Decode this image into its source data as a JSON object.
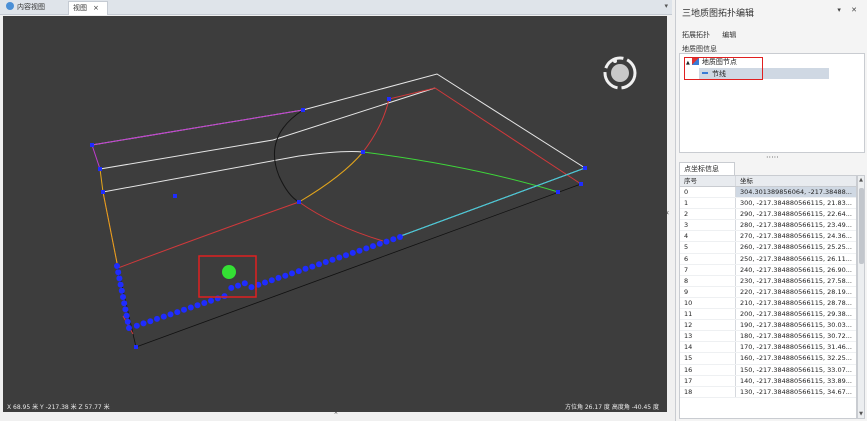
{
  "tabs": [
    {
      "label": "内容视图",
      "icon": "view-content-icon"
    },
    {
      "label": "视图",
      "close": "×",
      "icon": "view-icon"
    }
  ],
  "tab_dropdown": "▾",
  "status": {
    "left": "X 68.95  米   Y -217.38  米   Z 57.77  米",
    "right": "方位角   26.17  度  高度角  -40.45  度"
  },
  "panel": {
    "title": "三地质图拓扑编辑",
    "title_icons": "▾ ✕",
    "toolbar": [
      "拓展拓扑",
      "编辑"
    ],
    "group_label": "地质图信息",
    "tree": [
      {
        "label": "地质图节点",
        "expander": "▲"
      },
      {
        "label": "节线"
      }
    ],
    "splitter": "·····",
    "coord_tab": "点坐标信息",
    "columns": [
      "序号",
      "坐标"
    ],
    "rows": [
      {
        "id": "0",
        "coord": "304.301389856064, -217.38488..."
      },
      {
        "id": "1",
        "coord": "300, -217.384880566115, 21.83..."
      },
      {
        "id": "2",
        "coord": "290, -217.384880566115, 22.64..."
      },
      {
        "id": "3",
        "coord": "280, -217.384880566115, 23.49..."
      },
      {
        "id": "4",
        "coord": "270, -217.384880566115, 24.36..."
      },
      {
        "id": "5",
        "coord": "260, -217.384880566115, 25.25..."
      },
      {
        "id": "6",
        "coord": "250, -217.384880566115, 26.11..."
      },
      {
        "id": "7",
        "coord": "240, -217.384880566115, 26.90..."
      },
      {
        "id": "8",
        "coord": "230, -217.384880566115, 27.58..."
      },
      {
        "id": "9",
        "coord": "220, -217.384880566115, 28.19..."
      },
      {
        "id": "10",
        "coord": "210, -217.384880566115, 28.78..."
      },
      {
        "id": "11",
        "coord": "200, -217.384880566115, 29.38..."
      },
      {
        "id": "12",
        "coord": "190, -217.384880566115, 30.03..."
      },
      {
        "id": "13",
        "coord": "180, -217.384880566115, 30.72..."
      },
      {
        "id": "14",
        "coord": "170, -217.384880566115, 31.46..."
      },
      {
        "id": "15",
        "coord": "160, -217.384880566115, 32.25..."
      },
      {
        "id": "16",
        "coord": "150, -217.384880566115, 33.07..."
      },
      {
        "id": "17",
        "coord": "140, -217.384880566115, 33.89..."
      },
      {
        "id": "18",
        "coord": "130, -217.384880566115, 34.67..."
      }
    ]
  },
  "colors": {
    "viewport_bg": "#3d3d3d",
    "highlight_red": "#e02020",
    "point_blue": "#1f2cff",
    "cursor_green": "#34e034"
  }
}
